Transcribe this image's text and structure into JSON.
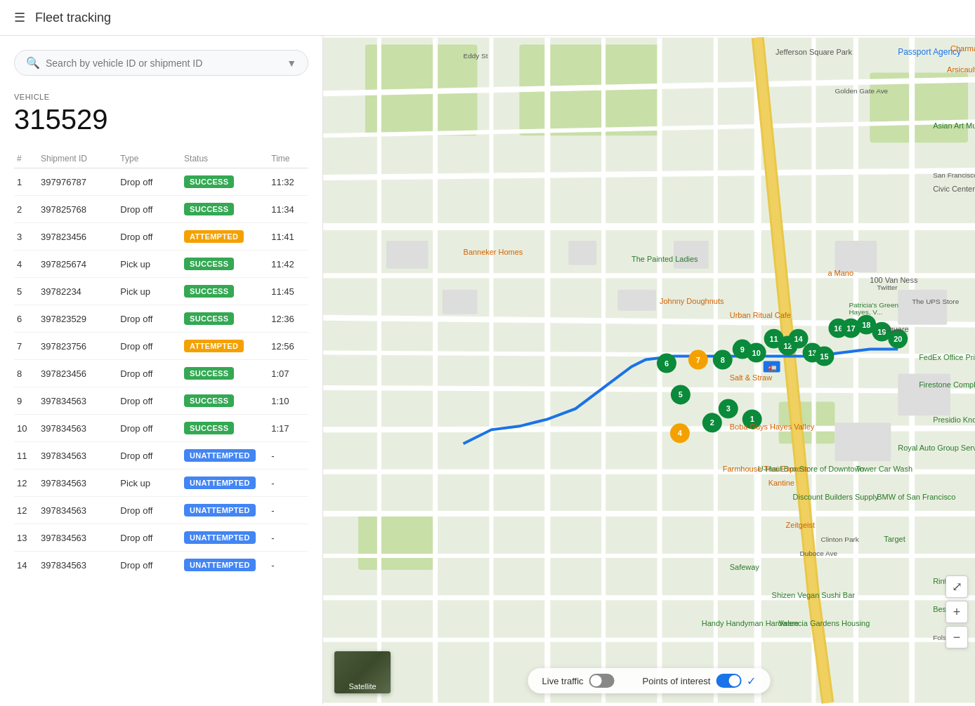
{
  "header": {
    "menu_icon": "☰",
    "title": "Fleet tracking"
  },
  "search": {
    "placeholder": "Search by vehicle ID or shipment ID"
  },
  "vehicle": {
    "label": "VEHICLE",
    "id": "315529"
  },
  "table": {
    "columns": [
      "#",
      "Shipment ID",
      "Type",
      "Status",
      "Time"
    ],
    "rows": [
      {
        "num": 1,
        "shipment_id": "397976787",
        "type": "Drop off",
        "status": "SUCCESS",
        "status_class": "success",
        "time": "11:32"
      },
      {
        "num": 2,
        "shipment_id": "397825768",
        "type": "Drop off",
        "status": "SUCCESS",
        "status_class": "success",
        "time": "11:34"
      },
      {
        "num": 3,
        "shipment_id": "397823456",
        "type": "Drop off",
        "status": "ATTEMPTED",
        "status_class": "attempted",
        "time": "11:41"
      },
      {
        "num": 4,
        "shipment_id": "397825674",
        "type": "Pick up",
        "status": "SUCCESS",
        "status_class": "success",
        "time": "11:42"
      },
      {
        "num": 5,
        "shipment_id": "39782234",
        "type": "Pick up",
        "status": "SUCCESS",
        "status_class": "success",
        "time": "11:45"
      },
      {
        "num": 6,
        "shipment_id": "397823529",
        "type": "Drop off",
        "status": "SUCCESS",
        "status_class": "success",
        "time": "12:36"
      },
      {
        "num": 7,
        "shipment_id": "397823756",
        "type": "Drop off",
        "status": "ATTEMPTED",
        "status_class": "attempted",
        "time": "12:56"
      },
      {
        "num": 8,
        "shipment_id": "397823456",
        "type": "Drop off",
        "status": "SUCCESS",
        "status_class": "success",
        "time": "1:07"
      },
      {
        "num": 9,
        "shipment_id": "397834563",
        "type": "Drop off",
        "status": "SUCCESS",
        "status_class": "success",
        "time": "1:10"
      },
      {
        "num": 10,
        "shipment_id": "397834563",
        "type": "Drop off",
        "status": "SUCCESS",
        "status_class": "success",
        "time": "1:17"
      },
      {
        "num": 11,
        "shipment_id": "397834563",
        "type": "Drop off",
        "status": "UNATTEMPTED",
        "status_class": "unattempted",
        "time": "-"
      },
      {
        "num": 12,
        "shipment_id": "397834563",
        "type": "Pick up",
        "status": "UNATTEMPTED",
        "status_class": "unattempted",
        "time": "-"
      },
      {
        "num": 12,
        "shipment_id": "397834563",
        "type": "Drop off",
        "status": "UNATTEMPTED",
        "status_class": "unattempted",
        "time": "-"
      },
      {
        "num": 13,
        "shipment_id": "397834563",
        "type": "Drop off",
        "status": "UNATTEMPTED",
        "status_class": "unattempted",
        "time": "-"
      },
      {
        "num": 14,
        "shipment_id": "397834563",
        "type": "Drop off",
        "status": "UNATTEMPTED",
        "status_class": "unattempted",
        "time": "-"
      }
    ]
  },
  "map": {
    "live_traffic_label": "Live traffic",
    "live_traffic_on": false,
    "poi_label": "Points of interest",
    "poi_on": true,
    "satellite_label": "Satellite",
    "zoom_in": "+",
    "zoom_out": "−",
    "fullscreen_icon": "⤢",
    "location_icon": "◎"
  }
}
